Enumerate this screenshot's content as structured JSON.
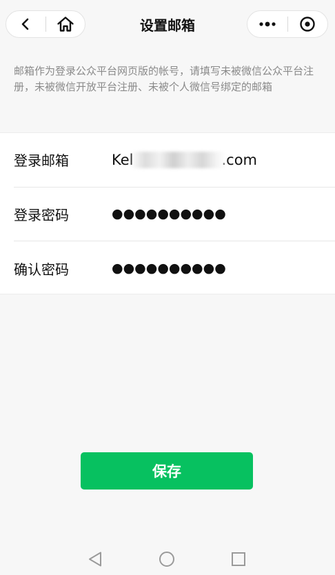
{
  "navbar": {
    "title": "设置邮箱",
    "icons": [
      "back-chevron-icon",
      "home-icon",
      "more-dots-icon",
      "close-target-icon"
    ]
  },
  "description": "邮箱作为登录公众平台网页版的帐号，请填写未被微信公众平台注册，未被微信开放平台注册、未被个人微信号绑定的邮箱",
  "form": {
    "email_label": "登录邮箱",
    "email_value_start": "Kel",
    "email_value_end": ".com",
    "password_label": "登录密码",
    "password_value": "●●●●●●●●●●",
    "confirm_label": "确认密码",
    "confirm_value": "●●●●●●●●●●"
  },
  "save_button": {
    "label": "保存"
  },
  "colors": {
    "accent": "#07c160",
    "background": "#f7f7f7",
    "description_text": "#8a8a8a"
  },
  "system_nav": {
    "icons": [
      "back-triangle-icon",
      "home-circle-icon",
      "recents-square-icon"
    ]
  }
}
